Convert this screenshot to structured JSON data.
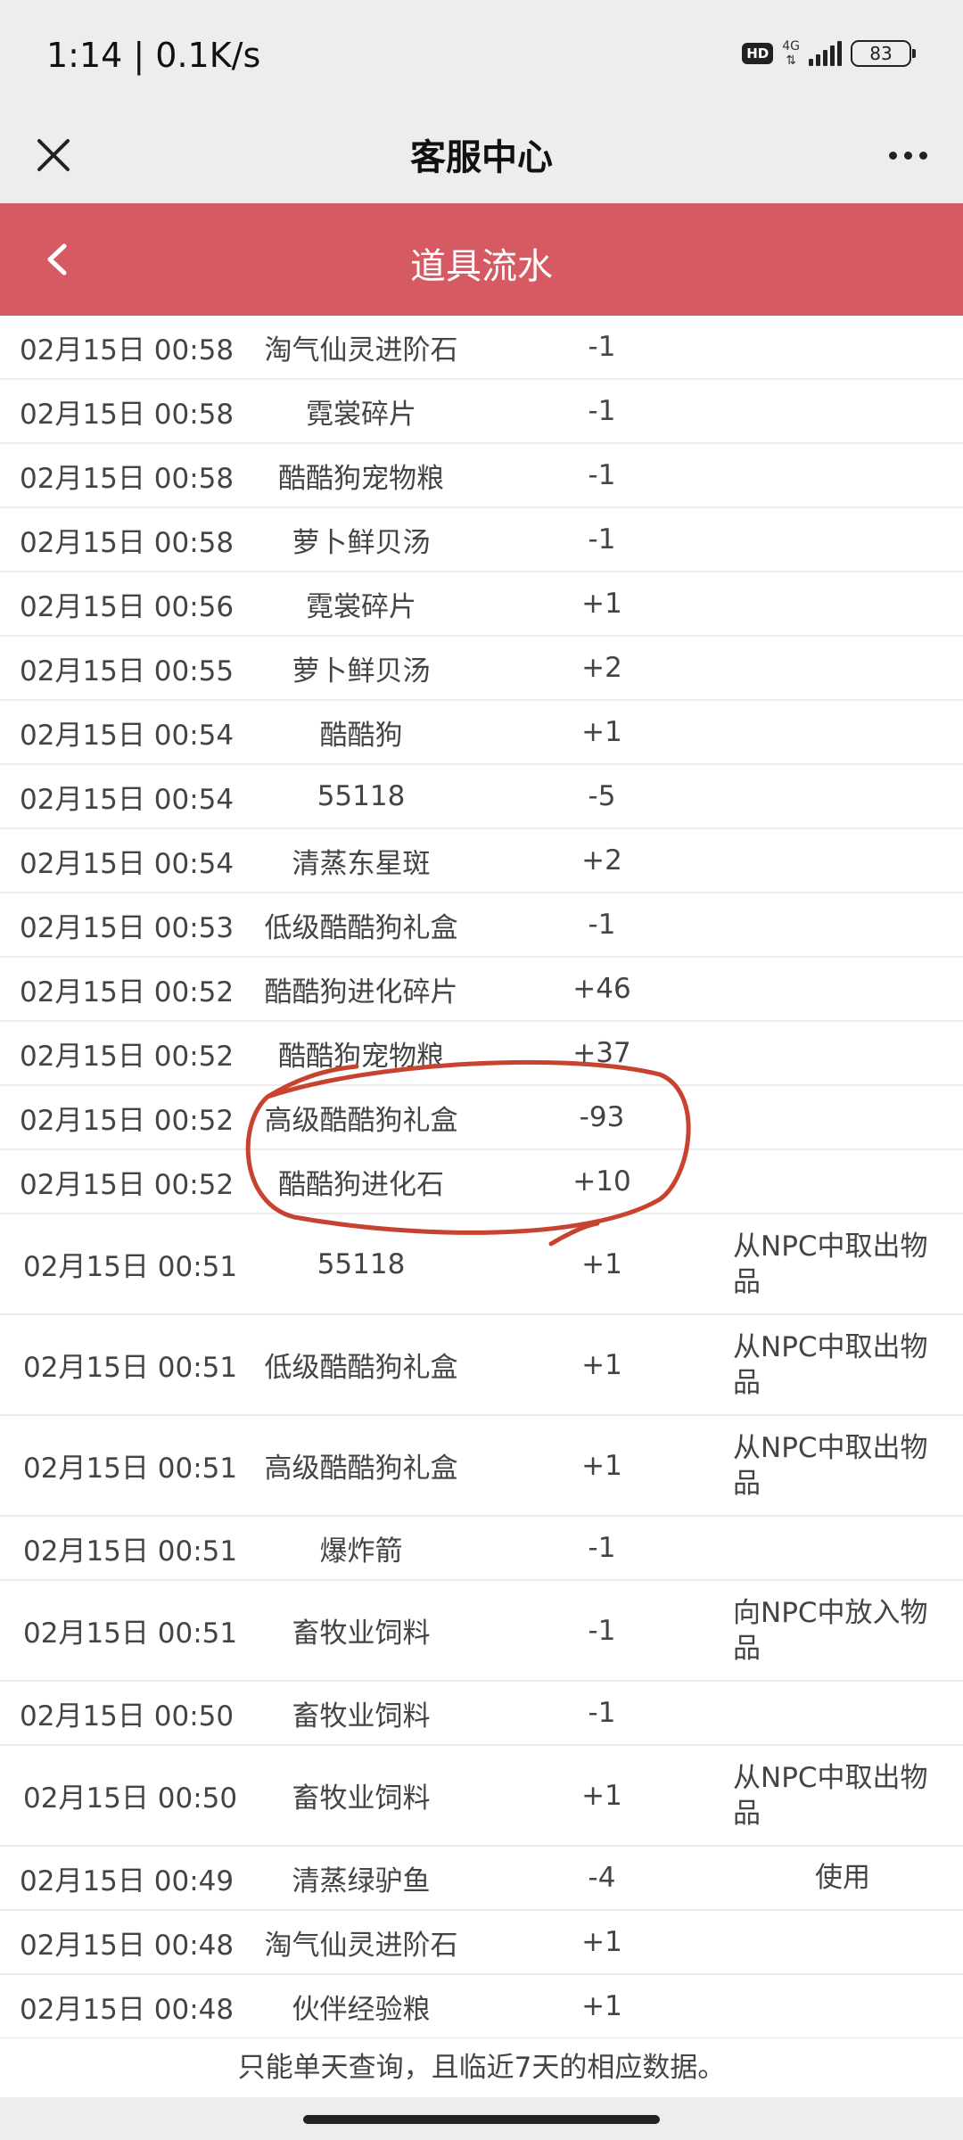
{
  "status_bar": {
    "time": "1:14 | 0.1K/s",
    "hd": "HD",
    "network": "4G",
    "battery": "83"
  },
  "nav": {
    "title": "客服中心",
    "close_icon": "close-icon",
    "more_icon": "more-icon"
  },
  "header": {
    "title": "道具流水",
    "back_icon": "back-chevron-icon",
    "color": "#d55a63"
  },
  "rows": [
    {
      "time": "02月15日 00:58",
      "item": "淘气仙灵进阶石",
      "qty": "-1",
      "note": ""
    },
    {
      "time": "02月15日 00:58",
      "item": "霓裳碎片",
      "qty": "-1",
      "note": ""
    },
    {
      "time": "02月15日 00:58",
      "item": "酷酷狗宠物粮",
      "qty": "-1",
      "note": ""
    },
    {
      "time": "02月15日 00:58",
      "item": "萝卜鲜贝汤",
      "qty": "-1",
      "note": ""
    },
    {
      "time": "02月15日 00:56",
      "item": "霓裳碎片",
      "qty": "+1",
      "note": ""
    },
    {
      "time": "02月15日 00:55",
      "item": "萝卜鲜贝汤",
      "qty": "+2",
      "note": ""
    },
    {
      "time": "02月15日 00:54",
      "item": "酷酷狗",
      "qty": "+1",
      "note": ""
    },
    {
      "time": "02月15日 00:54",
      "item": "55118",
      "qty": "-5",
      "note": ""
    },
    {
      "time": "02月15日 00:54",
      "item": "清蒸东星斑",
      "qty": "+2",
      "note": ""
    },
    {
      "time": "02月15日 00:53",
      "item": "低级酷酷狗礼盒",
      "qty": "-1",
      "note": ""
    },
    {
      "time": "02月15日 00:52",
      "item": "酷酷狗进化碎片",
      "qty": "+46",
      "note": ""
    },
    {
      "time": "02月15日 00:52",
      "item": "酷酷狗宠物粮",
      "qty": "+37",
      "note": ""
    },
    {
      "time": "02月15日 00:52",
      "item": "高级酷酷狗礼盒",
      "qty": "-93",
      "note": ""
    },
    {
      "time": "02月15日 00:52",
      "item": "酷酷狗进化石",
      "qty": "+10",
      "note": ""
    },
    {
      "time": "02月15日 00:51",
      "item": "55118",
      "qty": "+1",
      "note": "从NPC中取出物品"
    },
    {
      "time": "02月15日 00:51",
      "item": "低级酷酷狗礼盒",
      "qty": "+1",
      "note": "从NPC中取出物品"
    },
    {
      "time": "02月15日 00:51",
      "item": "高级酷酷狗礼盒",
      "qty": "+1",
      "note": "从NPC中取出物品"
    },
    {
      "time": "02月15日 00:51",
      "item": "爆炸箭",
      "qty": "-1",
      "note": ""
    },
    {
      "time": "02月15日 00:51",
      "item": "畜牧业饲料",
      "qty": "-1",
      "note": "向NPC中放入物品"
    },
    {
      "time": "02月15日 00:50",
      "item": "畜牧业饲料",
      "qty": "-1",
      "note": ""
    },
    {
      "time": "02月15日 00:50",
      "item": "畜牧业饲料",
      "qty": "+1",
      "note": "从NPC中取出物品"
    },
    {
      "time": "02月15日 00:49",
      "item": "清蒸绿驴鱼",
      "qty": "-4",
      "note": "使用"
    },
    {
      "time": "02月15日 00:48",
      "item": "淘气仙灵进阶石",
      "qty": "+1",
      "note": ""
    },
    {
      "time": "02月15日 00:48",
      "item": "伙伴经验粮",
      "qty": "+1",
      "note": ""
    }
  ],
  "footer": {
    "note": "只能单天查询，且临近7天的相应数据。"
  }
}
